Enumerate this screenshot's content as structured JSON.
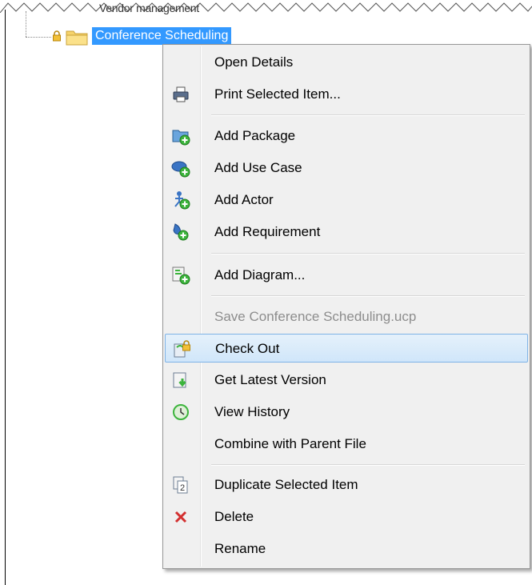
{
  "tree": {
    "parent_label": "Vendor management",
    "selected_label": "Conference Scheduling"
  },
  "menu": {
    "items": [
      {
        "label": "Open Details",
        "icon": "none"
      },
      {
        "label": "Print Selected Item...",
        "icon": "printer-icon"
      },
      {
        "label": "Add Package",
        "icon": "add-package-icon"
      },
      {
        "label": "Add Use Case",
        "icon": "add-use-case-icon"
      },
      {
        "label": "Add Actor",
        "icon": "add-actor-icon"
      },
      {
        "label": "Add Requirement",
        "icon": "add-requirement-icon"
      },
      {
        "label": "Add Diagram...",
        "icon": "add-diagram-icon"
      },
      {
        "label": "Save Conference Scheduling.ucp",
        "icon": "none",
        "disabled": true
      },
      {
        "label": "Check Out",
        "icon": "check-out-icon",
        "highlighted": true
      },
      {
        "label": "Get Latest Version",
        "icon": "get-latest-icon"
      },
      {
        "label": "View History",
        "icon": "history-icon"
      },
      {
        "label": "Combine with Parent File",
        "icon": "none"
      },
      {
        "label": "Duplicate Selected Item",
        "icon": "duplicate-icon"
      },
      {
        "label": "Delete",
        "icon": "delete-icon"
      },
      {
        "label": "Rename",
        "icon": "none"
      }
    ]
  },
  "colors": {
    "selection": "#3399ff",
    "highlight_border": "#7fb3e6",
    "delete_red": "#d32f2f",
    "add_green": "#3cb43c"
  }
}
